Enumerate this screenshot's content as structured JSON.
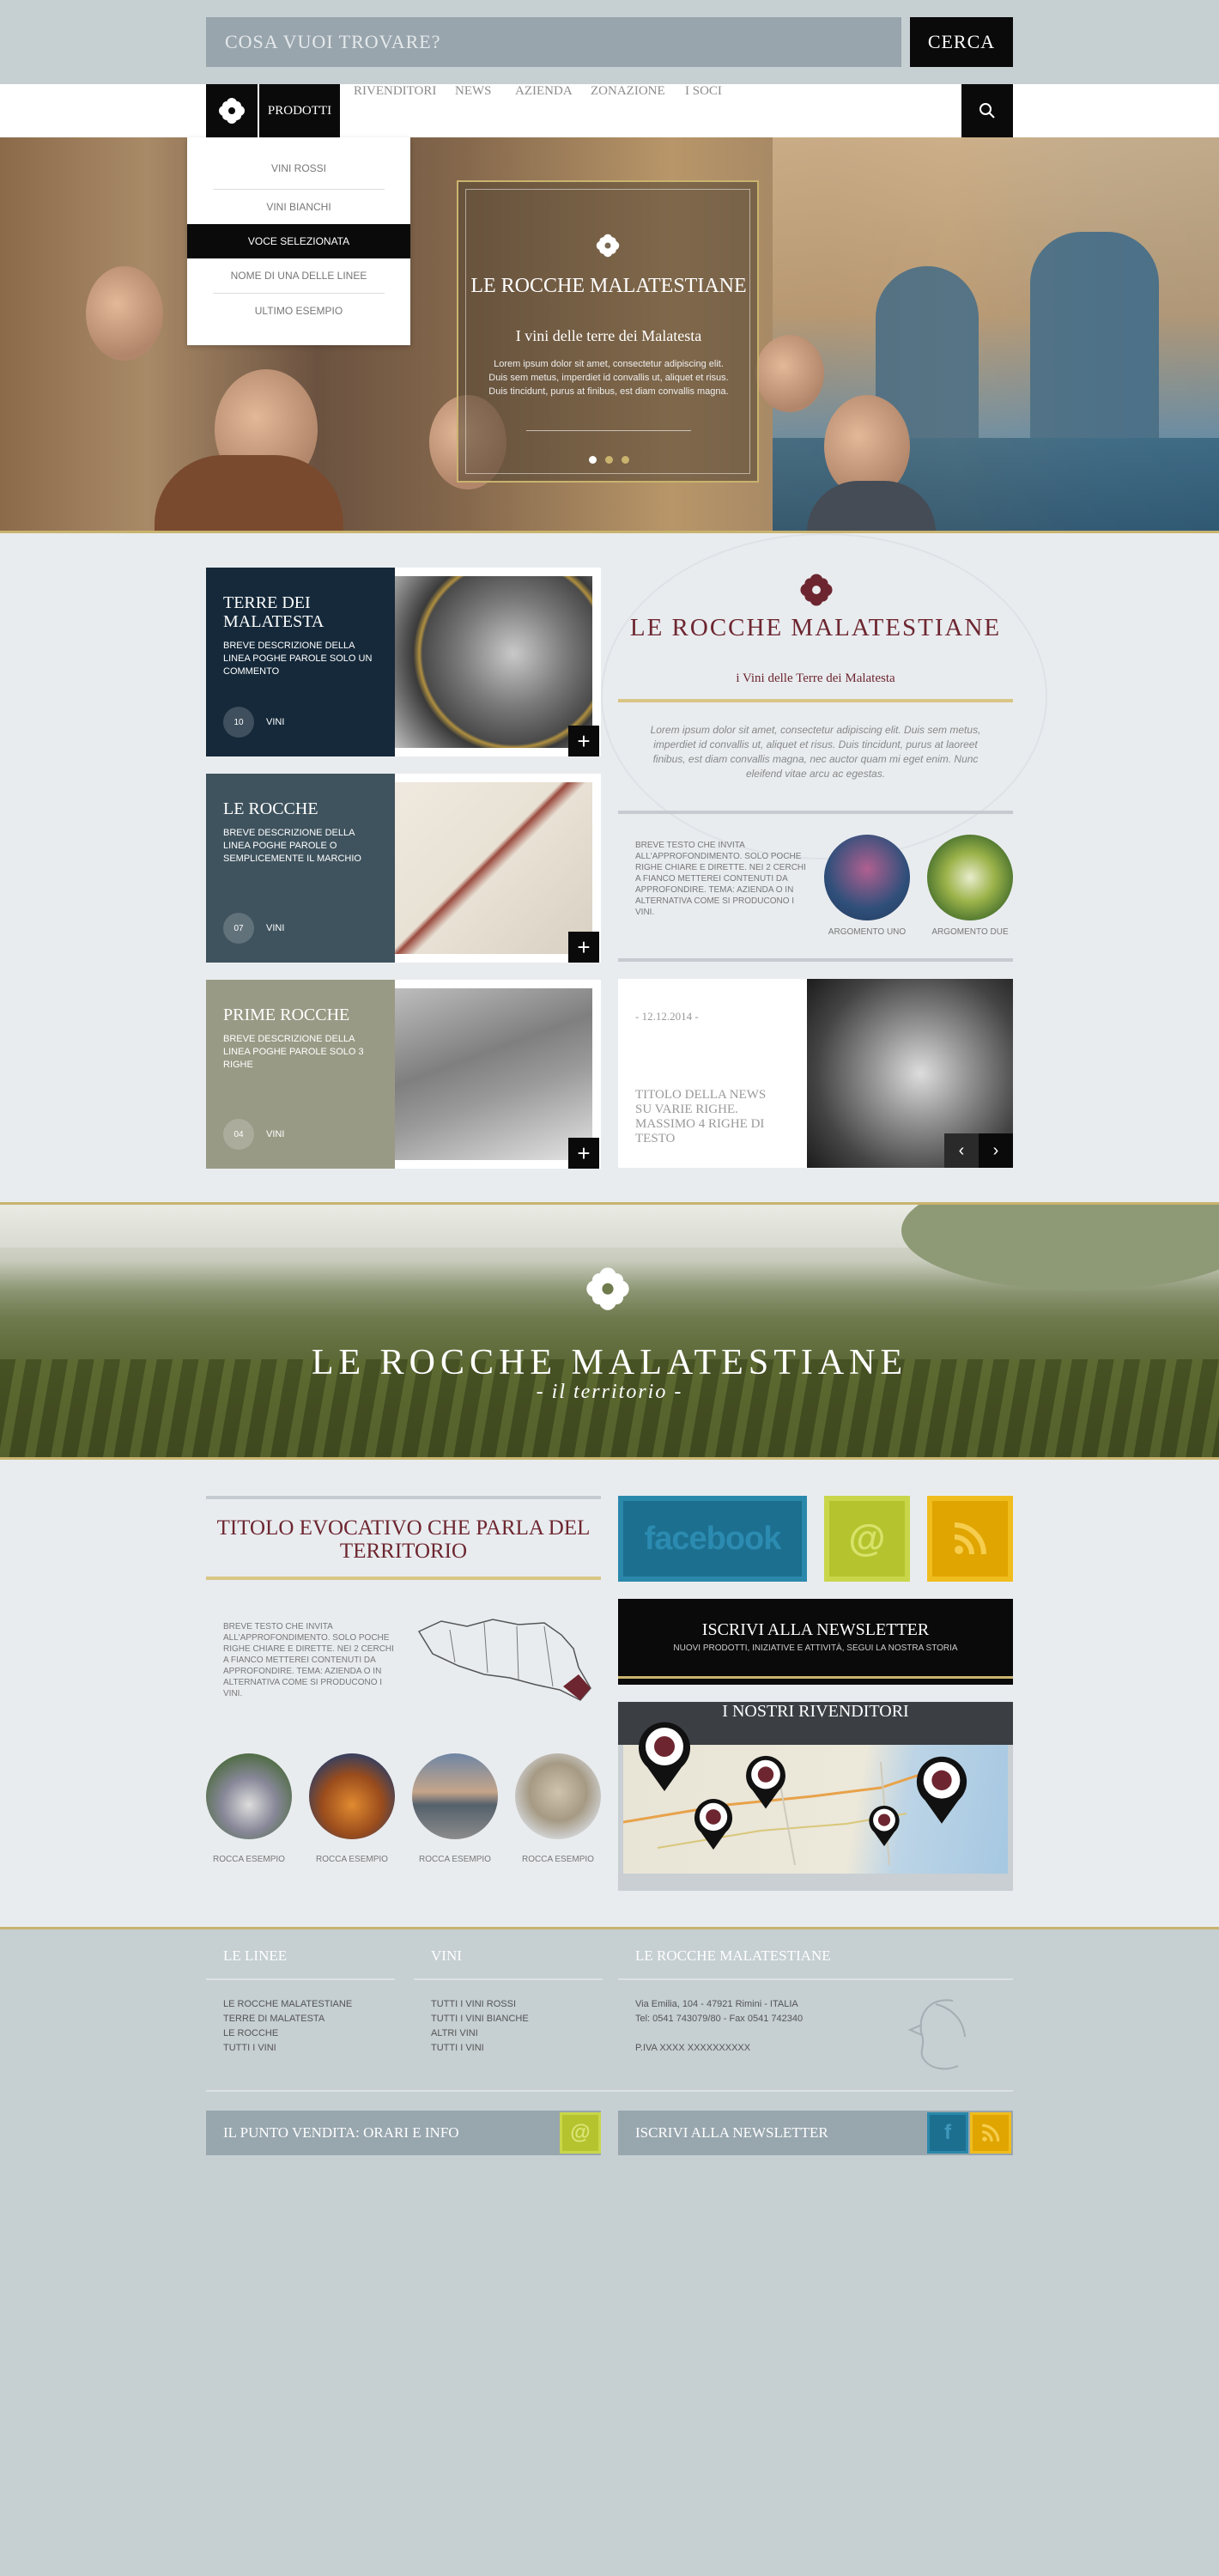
{
  "search": {
    "placeholder": "COSA VUOI TROVARE?",
    "button_label": "CERCA"
  },
  "nav": {
    "active": "PRODOTTI",
    "items": [
      "RIVENDITORI",
      "NEWS",
      "AZIENDA",
      "ZONAZIONE",
      "I SOCI"
    ]
  },
  "dropdown": {
    "items": [
      "VINI ROSSI",
      "VINI BIANCHI",
      "VOCE SELEZIONATA",
      "NOME DI UNA DELLE LINEE",
      "ULTIMO ESEMPIO"
    ]
  },
  "hero": {
    "title": "LE ROCCHE MALATESTIANE",
    "subtitle": "I vini delle terre dei Malatesta",
    "text": "Lorem ipsum dolor sit amet, consectetur adipiscing elit. Duis sem metus, imperdiet id convallis ut, aliquet et risus. Duis tincidunt, purus at finibus, est diam convallis magna."
  },
  "cards": [
    {
      "title": "TERRE DEI MALATESTA",
      "desc": "BREVE DESCRIZIONE DELLA LINEA POGHE PAROLE SOLO UN COMMENTO",
      "count": "10",
      "unit": "VINI",
      "color": "#15293a"
    },
    {
      "title": "LE ROCCHE",
      "desc": "BREVE DESCRIZIONE DELLA LINEA POGHE PAROLE O SEMPLICEMENTE IL MARCHIO",
      "count": "07",
      "unit": "VINI",
      "color": "#3f535e"
    },
    {
      "title": "PRIME ROCCHE",
      "desc": "BREVE DESCRIZIONE DELLA LINEA POGHE PAROLE SOLO 3 RIGHE",
      "count": "04",
      "unit": "VINI",
      "color": "#999a85"
    }
  ],
  "brand": {
    "name": "LE ROCCHE MALATESTIANE",
    "tagline": "i Vini delle Terre dei Malatesta",
    "text": "Lorem ipsum dolor sit amet, consectetur adipiscing elit. Duis sem metus, imperdiet id convallis ut, aliquet et risus. Duis tincidunt, purus at laoreet finibus, est diam convallis magna, nec auctor quam mi eget enim. Nunc eleifend vitae arcu ac egestas."
  },
  "argomenti": {
    "text": "BREVE TESTO CHE INVITA ALL'APPROFONDIMENTO. SOLO POCHE RIGHE CHIARE E DIRETTE. NEI 2 CERCHI A FIANCO METTEREI CONTENUTI DA APPROFONDIRE. TEMA: AZIENDA O IN ALTERNATIVA COME SI PRODUCONO I VINI.",
    "items": [
      "ARGOMENTO UNO",
      "ARGOMENTO DUE"
    ]
  },
  "news": {
    "date": "- 12.12.2014 -",
    "title": "TITOLO DELLA NEWS SU VARIE RIGHE. MASSIMO 4 RIGHE DI TESTO"
  },
  "territory": {
    "title": "LE ROCCHE MALATESTIANE",
    "subtitle": "- il territorio -"
  },
  "territorio": {
    "title": "TITOLO EVOCATIVO CHE PARLA DEL TERRITORIO",
    "text": "BREVE TESTO CHE INVITA ALL'APPROFONDIMENTO. SOLO POCHE RIGHE CHIARE E DIRETTE. NEI 2 CERCHI A FIANCO METTEREI CONTENUTI DA APPROFONDIRE. TEMA: AZIENDA O IN ALTERNATIVA COME SI PRODUCONO I VINI.",
    "rocche": [
      "ROCCA ESEMPIO",
      "ROCCA ESEMPIO",
      "ROCCA ESEMPIO",
      "ROCCA ESEMPIO"
    ]
  },
  "social": {
    "facebook": "facebook",
    "email_icon": "@",
    "rss_icon": "rss-icon"
  },
  "newsletter": {
    "title": "ISCRIVI ALLA NEWSLETTER",
    "subtitle": "NUOVI PRODOTTI, INIZIATIVE E ATTIVITÀ, SEGUI LA NOSTRA STORIA"
  },
  "map": {
    "title": "I NOSTRI RIVENDITORI"
  },
  "footer": {
    "linee": {
      "heading": "LE LINEE",
      "items": [
        "LE ROCCHE MALATESTIANE",
        "TERRE DI MALATESTA",
        "LE ROCCHE",
        "TUTTI I VINI"
      ]
    },
    "vini": {
      "heading": "VINI",
      "items": [
        "TUTTI I VINI ROSSI",
        "TUTTI I VINI BIANCHE",
        "ALTRI VINI",
        "TUTTI I VINI"
      ]
    },
    "company": {
      "heading": "LE ROCCHE MALATESTIANE",
      "address": "Via Emilia, 104 - 47921 Rimini - ITALIA",
      "phone": "Tel: 0541 743079/80 - Fax 0541 742340",
      "piva": "P.IVA XXXX XXXXXXXXXX"
    },
    "punto_vendita": "IL PUNTO VENDITA: ORARI E INFO",
    "newsletter": "ISCRIVI ALLA NEWSLETTER"
  },
  "colors": {
    "bordeaux": "#6d2630",
    "gold": "#c9b36e",
    "facebook": "#1c6f8f",
    "email": "#b5c42e",
    "rss": "#e0a500"
  }
}
